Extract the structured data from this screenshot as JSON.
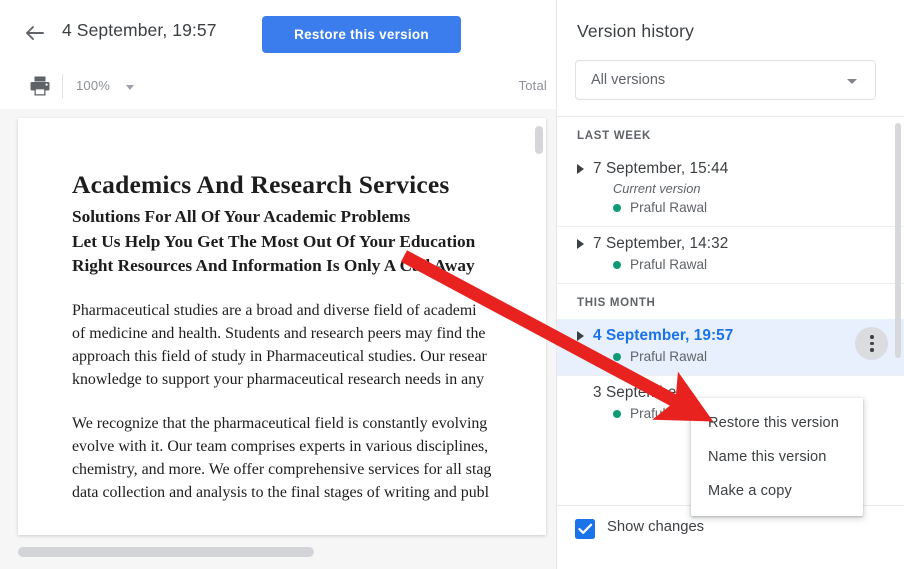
{
  "header": {
    "back_icon": "arrow-left-icon",
    "version_date": "4 September, 19:57",
    "restore_label": "Restore this version",
    "restore_color": "#3b7ded"
  },
  "toolbar": {
    "print_icon": "printer-icon",
    "zoom_value": "100%",
    "zoom_caret_icon": "chevron-down-icon",
    "right_label": "Total"
  },
  "document": {
    "title": "Academics And Research Services",
    "subtitles": [
      "Solutions For All Of Your Academic Problems",
      "Let Us Help You Get The Most Out Of Your Education",
      "Right Resources And Information Is Only A Call Away"
    ],
    "paragraph1": [
      "Pharmaceutical studies are a broad and diverse field of academi",
      "of medicine and health. Students and research peers may find the",
      "approach this field of study in Pharmaceutical studies. Our resear",
      "knowledge to support your pharmaceutical research needs in any"
    ],
    "paragraph2": [
      "We recognize that the pharmaceutical field is constantly evolving",
      "evolve with it. Our team comprises experts in various disciplines,",
      "chemistry, and more. We offer comprehensive services for all stag",
      "data collection and analysis to the final stages of writing and publ"
    ]
  },
  "version_history": {
    "title": "Version history",
    "filter_value": "All versions",
    "filter_caret_icon": "chevron-down-icon",
    "groups": [
      {
        "label": "LAST WEEK",
        "entries": [
          {
            "date": "7 September, 15:44",
            "current_label": "Current version",
            "author": "Praful Rawal",
            "author_color": "#0d9b76",
            "selected": false,
            "has_triangle": true,
            "has_more": false
          },
          {
            "date": "7 September, 14:32",
            "current_label": "",
            "author": "Praful Rawal",
            "author_color": "#0d9b76",
            "selected": false,
            "has_triangle": true,
            "has_more": false
          }
        ]
      },
      {
        "label": "THIS MONTH",
        "entries": [
          {
            "date": "4 September, 19:57",
            "current_label": "",
            "author": "Praful Rawal",
            "author_color": "#0d9b76",
            "selected": true,
            "has_triangle": true,
            "has_more": true,
            "more_icon": "more-vertical-icon"
          },
          {
            "date": "3 September",
            "current_label": "",
            "author": "Praful Rawal",
            "author_color": "#0d9b76",
            "selected": false,
            "has_triangle": false,
            "has_more": false
          }
        ]
      }
    ],
    "show_changes_label": "Show changes",
    "show_changes_checked": true,
    "show_changes_color": "#1a73e8"
  },
  "context_menu": {
    "items": [
      "Restore this version",
      "Name this version",
      "Make a copy"
    ]
  },
  "annotation": {
    "arrow_color": "#e8231f",
    "arrow_name": "red-pointer-arrow"
  }
}
